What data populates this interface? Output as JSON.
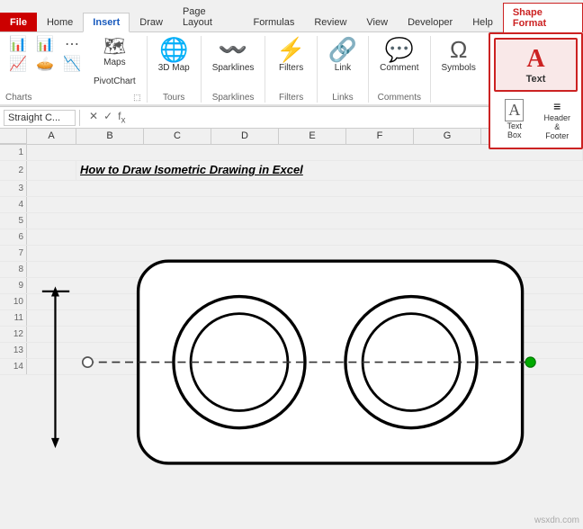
{
  "tabs": [
    {
      "id": "file",
      "label": "File",
      "active": false
    },
    {
      "id": "home",
      "label": "Home",
      "active": false
    },
    {
      "id": "insert",
      "label": "Insert",
      "active": true
    },
    {
      "id": "draw",
      "label": "Draw",
      "active": false
    },
    {
      "id": "page-layout",
      "label": "Page Layout",
      "active": false
    },
    {
      "id": "formulas",
      "label": "Formulas",
      "active": false
    },
    {
      "id": "review",
      "label": "Review",
      "active": false
    },
    {
      "id": "view",
      "label": "View",
      "active": false
    },
    {
      "id": "developer",
      "label": "Developer",
      "active": false
    },
    {
      "id": "help",
      "label": "Help",
      "active": false
    },
    {
      "id": "shape-format",
      "label": "Shape Format",
      "active": false,
      "special": true
    }
  ],
  "ribbon": {
    "groups": [
      {
        "id": "charts",
        "label": "Charts",
        "buttons": [
          {
            "id": "insert-col-chart",
            "icon": "📊",
            "label": ""
          },
          {
            "id": "insert-line-chart",
            "icon": "📈",
            "label": ""
          },
          {
            "id": "insert-pie-chart",
            "icon": "🥧",
            "label": ""
          },
          {
            "id": "maps",
            "icon": "🗺",
            "label": "Maps"
          },
          {
            "id": "pivot-chart",
            "icon": "📉",
            "label": "PivotChart"
          }
        ]
      },
      {
        "id": "tours",
        "label": "Tours",
        "buttons": [
          {
            "id": "3d-map",
            "icon": "🌐",
            "label": "3D Map"
          }
        ]
      },
      {
        "id": "sparklines",
        "label": "Sparklines",
        "buttons": [
          {
            "id": "sparklines",
            "icon": "〰",
            "label": "Sparklines"
          }
        ]
      },
      {
        "id": "filters",
        "label": "Filters",
        "buttons": [
          {
            "id": "filters",
            "icon": "⚡",
            "label": "Filters"
          }
        ]
      },
      {
        "id": "links",
        "label": "Links",
        "buttons": [
          {
            "id": "link",
            "icon": "🔗",
            "label": "Link"
          }
        ]
      },
      {
        "id": "comments",
        "label": "Comments",
        "buttons": [
          {
            "id": "comment",
            "icon": "💬",
            "label": "Comment"
          }
        ]
      }
    ],
    "text_group": {
      "text_btn": {
        "label": "Text",
        "icon": "A"
      },
      "text_box_btn": {
        "label": "Text Box",
        "icon": "A"
      },
      "header_footer_btn": {
        "label": "Header & Footer",
        "icon": "≡"
      },
      "symbols_btn": {
        "label": "Symbols",
        "icon": "Ω"
      }
    }
  },
  "formula_bar": {
    "name_box": "Straight C...",
    "placeholder": ""
  },
  "sheet": {
    "cols": [
      "A",
      "B",
      "C",
      "D",
      "E",
      "F",
      "G"
    ],
    "rows": [
      {
        "num": 1,
        "cells": []
      },
      {
        "num": 2,
        "cells": [
          {
            "col": "B",
            "value": "How to Draw Isometric Drawing in Excel",
            "class": "title-cell",
            "colspan": true
          }
        ]
      },
      {
        "num": 3,
        "cells": []
      },
      {
        "num": 4,
        "cells": []
      },
      {
        "num": 5,
        "cells": []
      },
      {
        "num": 6,
        "cells": []
      },
      {
        "num": 7,
        "cells": []
      },
      {
        "num": 8,
        "cells": []
      },
      {
        "num": 9,
        "cells": []
      },
      {
        "num": 10,
        "cells": []
      },
      {
        "num": 11,
        "cells": []
      },
      {
        "num": 12,
        "cells": []
      },
      {
        "num": 13,
        "cells": []
      },
      {
        "num": 14,
        "cells": []
      }
    ],
    "title_text": "How to Draw Isometric Drawing in Excel"
  },
  "watermark": "wsxdn.com"
}
